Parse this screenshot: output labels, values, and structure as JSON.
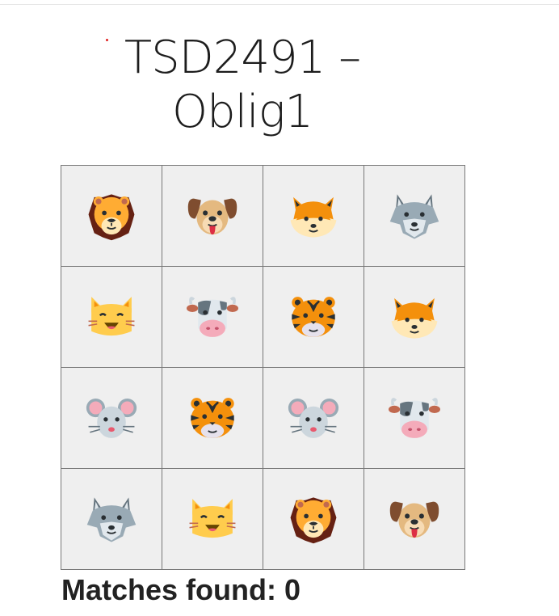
{
  "title_lines": [
    "TSD2491 –",
    "Oblig1"
  ],
  "board": {
    "cards": [
      {
        "animal": "lion"
      },
      {
        "animal": "dog"
      },
      {
        "animal": "fox"
      },
      {
        "animal": "wolf"
      },
      {
        "animal": "cat"
      },
      {
        "animal": "cow"
      },
      {
        "animal": "tiger"
      },
      {
        "animal": "fox"
      },
      {
        "animal": "mouse"
      },
      {
        "animal": "tiger"
      },
      {
        "animal": "mouse"
      },
      {
        "animal": "cow"
      },
      {
        "animal": "wolf"
      },
      {
        "animal": "cat"
      },
      {
        "animal": "lion"
      },
      {
        "animal": "dog"
      }
    ]
  },
  "status": {
    "matches_label": "Matches found: 0"
  }
}
